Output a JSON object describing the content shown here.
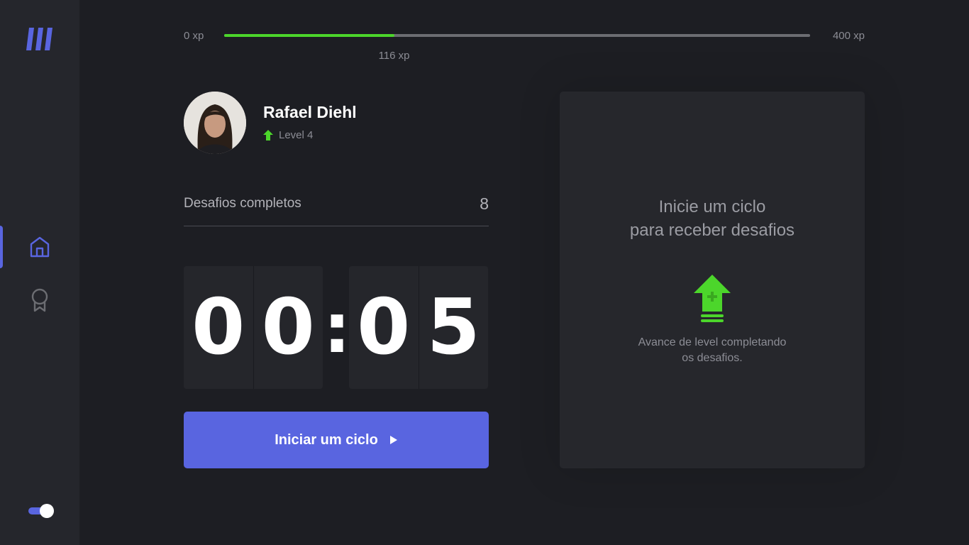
{
  "sidebar": {
    "logo": "move-it-logo",
    "nav": [
      {
        "icon": "home-icon",
        "active": true
      },
      {
        "icon": "award-icon",
        "active": false
      }
    ],
    "theme_toggle": "on"
  },
  "xp": {
    "min_label": "0 xp",
    "max_label": "400 xp",
    "current_label": "116 xp",
    "current": 116,
    "max": 400
  },
  "profile": {
    "name": "Rafael Diehl",
    "level_label": "Level 4"
  },
  "stats": {
    "completed_label": "Desafios completos",
    "completed_count": "8"
  },
  "countdown": {
    "minute_left": "0",
    "minute_right": "0",
    "separator": ":",
    "second_left": "0",
    "second_right": "5"
  },
  "actions": {
    "start_label": "Iniciar um ciclo"
  },
  "challenge_box": {
    "title_line1": "Inicie um ciclo",
    "title_line2": "para receber desafios",
    "desc_line1": "Avance de level completando",
    "desc_line2": "os desafios."
  },
  "colors": {
    "accent": "#5965e0",
    "green": "#4cd62b",
    "background": "#1d1e23",
    "panel": "#26272c"
  }
}
